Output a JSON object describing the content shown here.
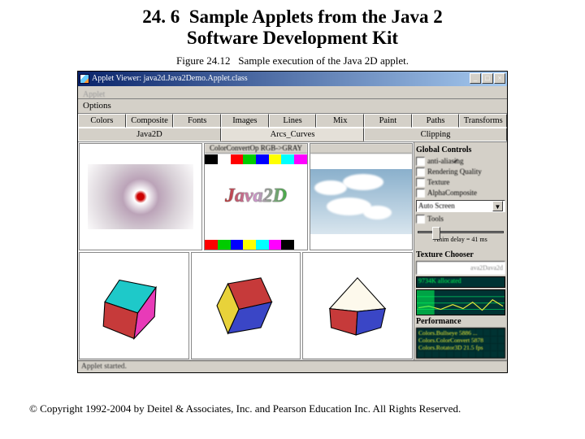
{
  "heading": {
    "number": "24. 6",
    "title_l1": "Sample Applets from the Java 2",
    "title_l2": "Software Development Kit"
  },
  "figure": {
    "label": "Figure 24.12",
    "caption": "Sample execution of the Java 2D applet."
  },
  "window": {
    "title": "Applet Viewer: java2d.Java2Demo.Applet.class",
    "sys": {
      "min": "_",
      "max": "□",
      "close": "×"
    },
    "menu": {
      "applet": "Applet"
    },
    "options": "Options",
    "tabs_row1": [
      "Colors",
      "Composite",
      "Fonts",
      "Images",
      "Lines",
      "Mix",
      "Paint",
      "Paths",
      "Transforms"
    ],
    "tabs_row2": [
      "Java2D",
      "Arcs_Curves",
      "Clipping"
    ],
    "active_tab2": 1,
    "panels": {
      "p1_label": "",
      "p2_label": "ColorConvertOp RGB->GRAY",
      "p2_text": "Java2D",
      "p3_label": ""
    },
    "side": {
      "hdr1": "Global Controls",
      "checks": [
        {
          "label": "anti-aliasing",
          "on": true
        },
        {
          "label": "Rendering Quality",
          "on": false
        },
        {
          "label": "Texture",
          "on": false
        },
        {
          "label": "AlphaComposite",
          "on": false
        }
      ],
      "select": "Auto Screen",
      "tools": {
        "label": "Tools",
        "on": false
      },
      "slider": "Anim delay = 41 ms",
      "hdr2": "Texture Chooser",
      "texpick": "ava2Dava2d",
      "memlabel": "9734K allocated",
      "hdr3": "Performance",
      "perf": [
        "Colors.Bullseye 5886 ...",
        "Colors.ColorConvert 5878",
        "Colors.Rotator3D 21.5 fps"
      ]
    },
    "status": "Applet started."
  },
  "copyright": "© Copyright 1992-2004 by Deitel & Associates, Inc. and Pearson Education Inc. All Rights Reserved."
}
